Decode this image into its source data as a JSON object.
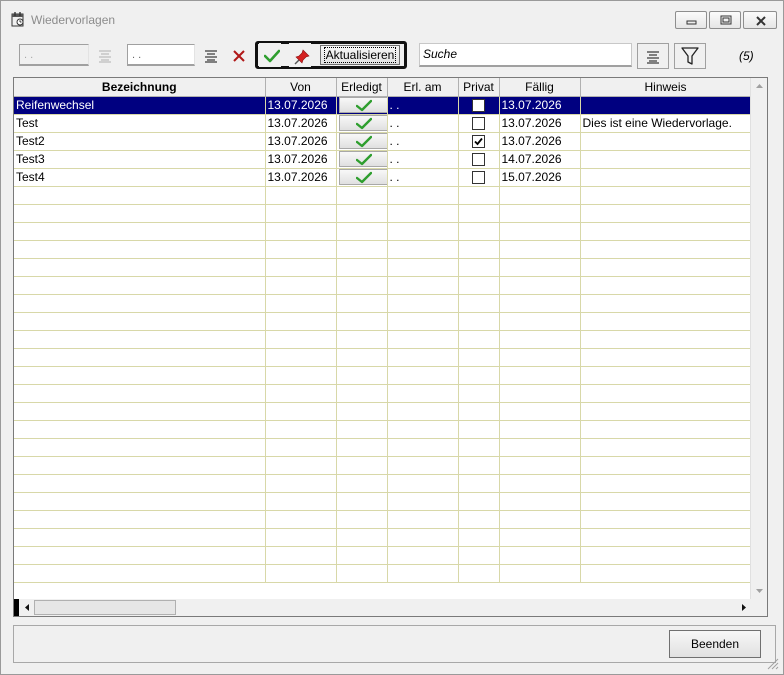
{
  "window": {
    "title": "Wiedervorlagen"
  },
  "toolbar": {
    "date_from": ". .",
    "date_to": ". .",
    "refresh_label": "Aktualisieren",
    "search_value": "Suche",
    "count": "(5)"
  },
  "table": {
    "columns": [
      "Bezeichnung",
      "Von",
      "Erledigt",
      "Erl. am",
      "Privat",
      "Fällig",
      "Hinweis"
    ],
    "rows": [
      {
        "bezeichnung": "Reifenwechsel",
        "von": "13.07.2026",
        "erl_am": ". .",
        "privat": false,
        "faellig": "13.07.2026",
        "hinweis": "",
        "selected": true
      },
      {
        "bezeichnung": "Test",
        "von": "13.07.2026",
        "erl_am": ". .",
        "privat": false,
        "faellig": "13.07.2026",
        "hinweis": "Dies ist eine Wiedervorlage.",
        "selected": false
      },
      {
        "bezeichnung": "Test2",
        "von": "13.07.2026",
        "erl_am": ". .",
        "privat": true,
        "faellig": "13.07.2026",
        "hinweis": "",
        "selected": false
      },
      {
        "bezeichnung": "Test3",
        "von": "13.07.2026",
        "erl_am": ". .",
        "privat": false,
        "faellig": "14.07.2026",
        "hinweis": "",
        "selected": false
      },
      {
        "bezeichnung": "Test4",
        "von": "13.07.2026",
        "erl_am": ". .",
        "privat": false,
        "faellig": "15.07.2026",
        "hinweis": "",
        "selected": false
      }
    ]
  },
  "footer": {
    "close_label": "Beenden"
  },
  "colors": {
    "selection": "#000080",
    "grid_line": "#d8d8a8",
    "check_green": "#2e9e2e",
    "pin_red": "#d42020"
  },
  "icons": [
    "calendar-icon",
    "minimize-icon",
    "restore-icon",
    "close-icon",
    "list-icon",
    "delete-icon",
    "checkmark-icon",
    "pin-icon",
    "filter-icon"
  ]
}
